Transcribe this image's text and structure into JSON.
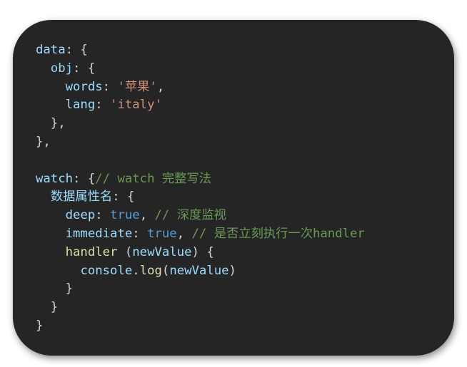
{
  "code": {
    "lines": [
      [
        {
          "t": "data",
          "c": "prop"
        },
        {
          "t": ": {",
          "c": "punc"
        }
      ],
      [
        {
          "t": "  ",
          "c": "punc"
        },
        {
          "t": "obj",
          "c": "prop"
        },
        {
          "t": ": {",
          "c": "punc"
        }
      ],
      [
        {
          "t": "    ",
          "c": "punc"
        },
        {
          "t": "words",
          "c": "prop"
        },
        {
          "t": ": ",
          "c": "punc"
        },
        {
          "t": "'苹果'",
          "c": "str"
        },
        {
          "t": ",",
          "c": "punc"
        }
      ],
      [
        {
          "t": "    ",
          "c": "punc"
        },
        {
          "t": "lang",
          "c": "prop"
        },
        {
          "t": ": ",
          "c": "punc"
        },
        {
          "t": "'italy'",
          "c": "str"
        }
      ],
      [
        {
          "t": "  },",
          "c": "punc"
        }
      ],
      [
        {
          "t": "},",
          "c": "punc"
        }
      ],
      [],
      [
        {
          "t": "watch",
          "c": "prop"
        },
        {
          "t": ": {",
          "c": "punc"
        },
        {
          "t": "// watch 完整写法",
          "c": "cmt"
        }
      ],
      [
        {
          "t": "  ",
          "c": "punc"
        },
        {
          "t": "数据属性名",
          "c": "prop"
        },
        {
          "t": ": {",
          "c": "punc"
        }
      ],
      [
        {
          "t": "    ",
          "c": "punc"
        },
        {
          "t": "deep",
          "c": "prop"
        },
        {
          "t": ": ",
          "c": "punc"
        },
        {
          "t": "true",
          "c": "kw"
        },
        {
          "t": ", ",
          "c": "punc"
        },
        {
          "t": "// 深度监视",
          "c": "cmt"
        }
      ],
      [
        {
          "t": "    ",
          "c": "punc"
        },
        {
          "t": "immediate",
          "c": "prop"
        },
        {
          "t": ": ",
          "c": "punc"
        },
        {
          "t": "true",
          "c": "kw"
        },
        {
          "t": ", ",
          "c": "punc"
        },
        {
          "t": "// 是否立刻执行一次handler",
          "c": "cmt"
        }
      ],
      [
        {
          "t": "    ",
          "c": "punc"
        },
        {
          "t": "handler",
          "c": "fn"
        },
        {
          "t": " (",
          "c": "punc"
        },
        {
          "t": "newValue",
          "c": "prop"
        },
        {
          "t": ") {",
          "c": "punc"
        }
      ],
      [
        {
          "t": "      ",
          "c": "punc"
        },
        {
          "t": "console",
          "c": "prop"
        },
        {
          "t": ".",
          "c": "punc"
        },
        {
          "t": "log",
          "c": "fn"
        },
        {
          "t": "(",
          "c": "punc"
        },
        {
          "t": "newValue",
          "c": "prop"
        },
        {
          "t": ")",
          "c": "punc"
        }
      ],
      [
        {
          "t": "    }",
          "c": "punc"
        }
      ],
      [
        {
          "t": "  }",
          "c": "punc"
        }
      ],
      [
        {
          "t": "}",
          "c": "punc"
        }
      ]
    ]
  }
}
